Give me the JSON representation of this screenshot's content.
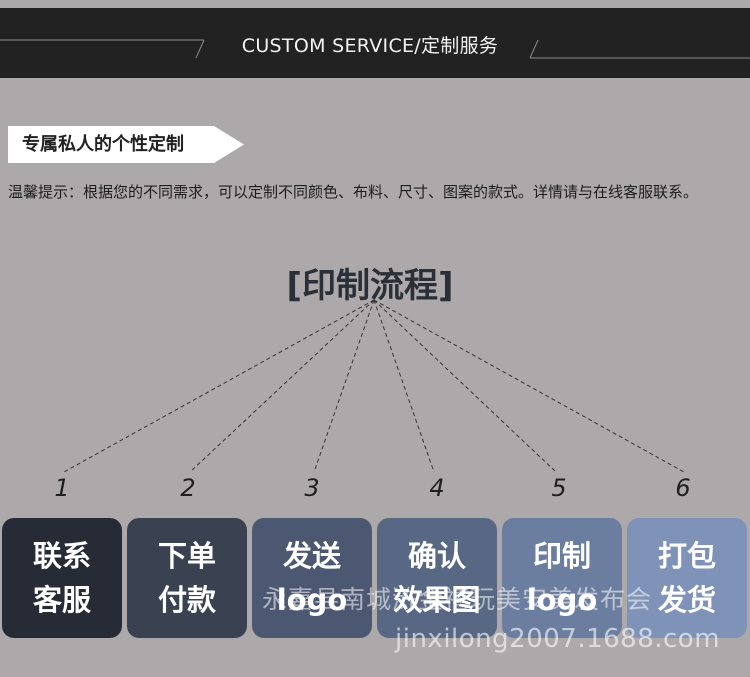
{
  "header": {
    "title": "CUSTOM SERVICE/定制服务"
  },
  "tag": {
    "label": "专属私人的个性定制"
  },
  "tip": {
    "text": "温馨提示：根据您的不同需求，可以定制不同颜色、布料、尺寸、图案的款式。详情请与在线客服联系。"
  },
  "process": {
    "title": "[印制流程]"
  },
  "steps": [
    {
      "num": "1",
      "line1": "联系",
      "line2": "客服",
      "color": "#262b36"
    },
    {
      "num": "2",
      "line1": "下单",
      "line2": "付款",
      "color": "#3a4252"
    },
    {
      "num": "3",
      "line1": "发送",
      "line2": "logo",
      "color": "#4c5872"
    },
    {
      "num": "4",
      "line1": "确认",
      "line2": "效果图",
      "color": "#586784"
    },
    {
      "num": "5",
      "line1": "印制",
      "line2": "logo",
      "color": "#6b7ea0"
    },
    {
      "num": "6",
      "line1": "打包",
      "line2": "发货",
      "color": "#7f93b8"
    }
  ],
  "watermark": {
    "text": "永嘉县南城浒金禧玩美安美发布会",
    "url": "jinxilong2007.1688.com"
  }
}
